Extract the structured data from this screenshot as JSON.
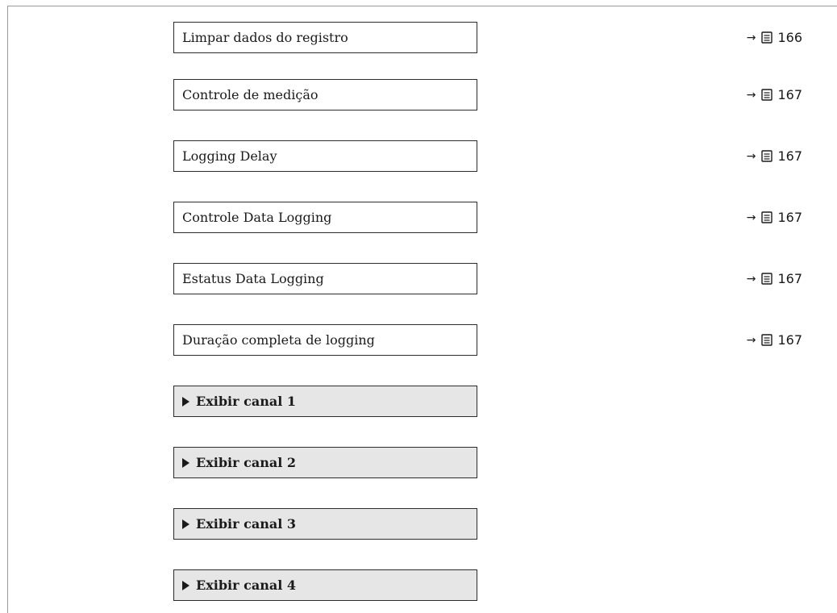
{
  "parameters": [
    {
      "label": "Limpar dados do registro",
      "page": "166",
      "ref_icon": "arrow-right-icon",
      "page_icon": "book-icon"
    },
    {
      "label": "Controle de medição",
      "page": "167",
      "ref_icon": "arrow-right-icon",
      "page_icon": "book-icon"
    },
    {
      "label": "Logging Delay",
      "page": "167",
      "ref_icon": "arrow-right-icon",
      "page_icon": "book-icon"
    },
    {
      "label": "Controle Data Logging",
      "page": "167",
      "ref_icon": "arrow-right-icon",
      "page_icon": "book-icon"
    },
    {
      "label": "Estatus Data Logging",
      "page": "167",
      "ref_icon": "arrow-right-icon",
      "page_icon": "book-icon"
    },
    {
      "label": "Duração completa de logging",
      "page": "167",
      "ref_icon": "arrow-right-icon",
      "page_icon": "book-icon"
    }
  ],
  "submenus": [
    {
      "label": "Exibir canal 1",
      "icon": "triangle-right-icon"
    },
    {
      "label": "Exibir canal 2",
      "icon": "triangle-right-icon"
    },
    {
      "label": "Exibir canal 3",
      "icon": "triangle-right-icon"
    },
    {
      "label": "Exibir canal 4",
      "icon": "triangle-right-icon"
    }
  ],
  "symbols": {
    "arrow": "→"
  },
  "colors": {
    "submenu_background": "#e6e6e6",
    "box_border": "#2b2b2b",
    "frame_line": "#9a9a9a"
  }
}
